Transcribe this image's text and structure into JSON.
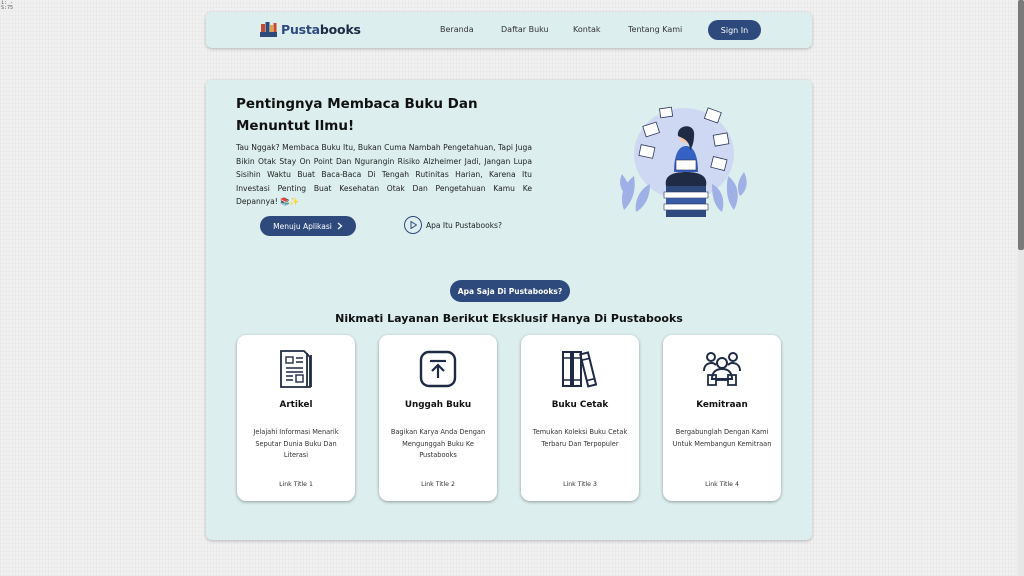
{
  "corner": "i: -\nS:75",
  "brand": {
    "name_part1": "Pusta",
    "name_part2": "books"
  },
  "nav": {
    "links": [
      "Beranda",
      "Daftar Buku",
      "Kontak",
      "Tentang Kami"
    ],
    "signin": "Sign In"
  },
  "hero": {
    "title": "Pentingnya Membaca Buku Dan Menuntut Ilmu!",
    "description": "Tau Nggak? Membaca Buku Itu, Bukan Cuma Nambah Pengetahuan, Tapi Juga Bikin Otak Stay On Point Dan Ngurangin Risiko Alzheimer Jadi, Jangan Lupa Sisihin Waktu Buat Baca-Baca Di Tengah Rutinitas Harian, Karena Itu Investasi Penting Buat Kesehatan Otak Dan Pengetahuan Kamu Ke Depannya! 📚✨",
    "cta_label": "Menuju Aplikasi",
    "video_label": "Apa Itu Pustabooks?"
  },
  "services": {
    "pill": "Apa Saja Di Pustabooks?",
    "title": "Nikmati Layanan Berikut Eksklusif Hanya Di Pustabooks",
    "cards": [
      {
        "icon": "document-icon",
        "title": "Artikel",
        "desc": "Jelajahi Informasi Menarik Seputar Dunia Buku Dan Literasi",
        "link": "Link Title 1"
      },
      {
        "icon": "upload-icon",
        "title": "Unggah Buku",
        "desc": "Bagikan Karya Anda Dengan Mengunggah Buku Ke Pustabooks",
        "link": "Link Title 2"
      },
      {
        "icon": "books-icon",
        "title": "Buku Cetak",
        "desc": "Temukan Koleksi Buku Cetak Terbaru Dan Terpopuler",
        "link": "Link Title 3"
      },
      {
        "icon": "partnership-icon",
        "title": "Kemitraan",
        "desc": "Bergabunglah Dengan Kami Untuk Membangun Kemitraan",
        "link": "Link Title 4"
      }
    ]
  },
  "colors": {
    "primary": "#2e4a7d",
    "panel": "#dcefee",
    "background": "#f1f1f1"
  }
}
